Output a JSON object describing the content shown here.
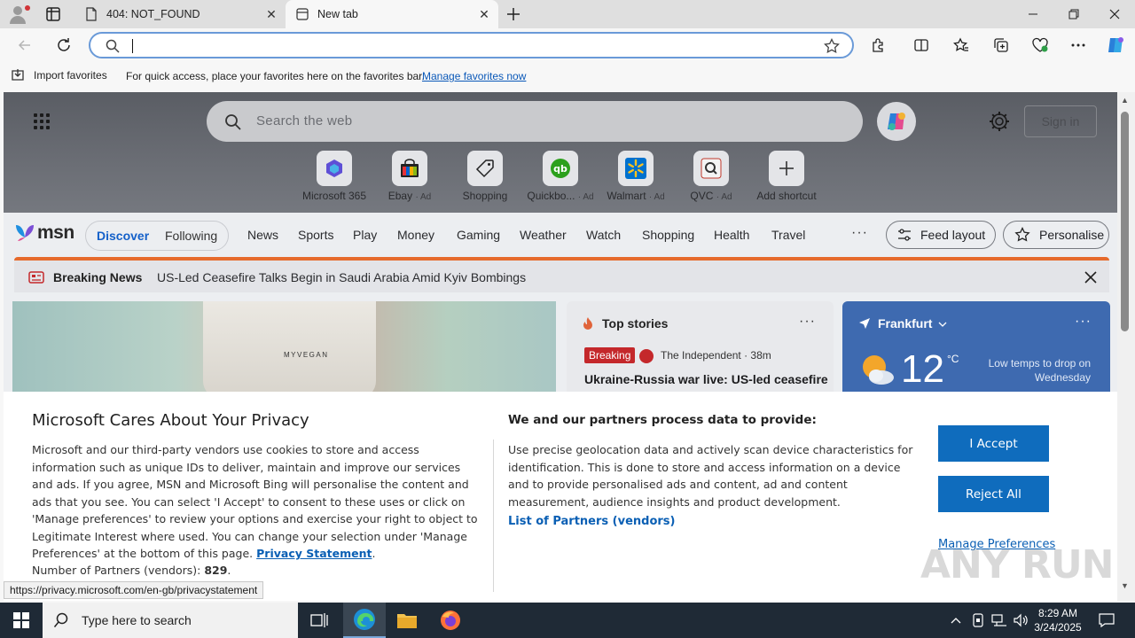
{
  "browser": {
    "tabs": [
      {
        "label": "404: NOT_FOUND",
        "close": "✕"
      },
      {
        "label": "New tab",
        "close": "✕"
      }
    ],
    "address": {
      "value": ""
    },
    "favorites_bar": {
      "import_label": "Import favorites",
      "hint": "For quick access, place your favorites here on the favorites bar.",
      "manage_link": "Manage favorites now"
    },
    "status_url": "https://privacy.microsoft.com/en-gb/privacystatement"
  },
  "newtab": {
    "search_placeholder": "Search the web",
    "sign_in": "Sign in",
    "shortcuts": [
      {
        "label": "Microsoft 365",
        "ad": ""
      },
      {
        "label": "Ebay",
        "ad": "· Ad"
      },
      {
        "label": "Shopping",
        "ad": ""
      },
      {
        "label": "Quickbo...",
        "ad": "· Ad"
      },
      {
        "label": "Walmart",
        "ad": "· Ad"
      },
      {
        "label": "QVC",
        "ad": "· Ad"
      },
      {
        "label": "Add shortcut",
        "ad": ""
      }
    ]
  },
  "msn": {
    "logo": "msn",
    "discover": "Discover",
    "following": "Following",
    "nav": [
      "News",
      "Sports",
      "Play",
      "Money",
      "Gaming",
      "Weather",
      "Watch",
      "Shopping",
      "Health",
      "Travel"
    ],
    "more": "···",
    "feed_layout": "Feed layout",
    "personalise": "Personalise",
    "breaking_title": "Breaking News",
    "breaking_text": "US-Led Ceasefire Talks Begin in Saudi Arabia Amid Kyiv Bombings",
    "hero_brand": "MYVEGAN",
    "top_stories": {
      "title": "Top stories",
      "more": "···",
      "tag": "Breaking",
      "source": "The Independent · 38m",
      "headline": "Ukraine-Russia war live: US-led ceasefire"
    },
    "weather": {
      "city": "Frankfurt",
      "more": "···",
      "temp": "12",
      "unit": "°C",
      "note": "Low temps to drop on Wednesday"
    }
  },
  "consent": {
    "title": "Microsoft Cares About Your Privacy",
    "body": "Microsoft and our third-party vendors use cookies to store and access information such as unique IDs to deliver, maintain and improve our services and ads. If you agree, MSN and Microsoft Bing will personalise the content and ads that you see. You can select 'I Accept' to consent to these uses or click on 'Manage preferences' to review your options and exercise your right to object to Legitimate Interest where used.  You can change your selection under 'Manage Preferences' at the bottom of this page.",
    "privacy_link": "Privacy Statement",
    "partners_label": "Number of Partners (vendors):",
    "partners_count": "829",
    "right_title": "We and our partners process data to provide:",
    "right_body": "Use precise geolocation data and actively scan device characteristics for identification. This is done to store and access information on a device and to provide personalised ads and content, ad and content measurement, audience insights and product development.",
    "list_link": "List of Partners (vendors)",
    "accept": "I Accept",
    "reject": "Reject All",
    "manage": "Manage Preferences"
  },
  "watermark": "ANY RUN",
  "taskbar": {
    "search_placeholder": "Type here to search",
    "time": "8:29 AM",
    "date": "3/24/2025"
  },
  "colors": {
    "accent": "#0f6cbd",
    "breaking_bar": "#e66a2c",
    "weather_card": "#3e6ab0",
    "taskbar": "#1f2a36"
  }
}
